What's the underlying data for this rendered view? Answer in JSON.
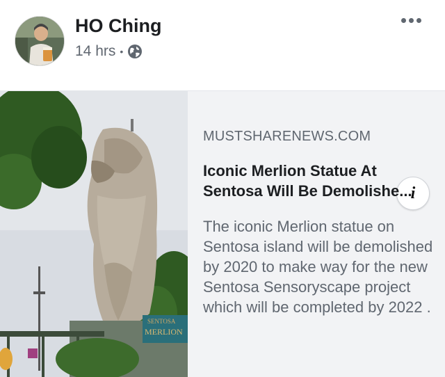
{
  "post": {
    "author": "HO Ching",
    "time": "14 hrs",
    "separator": "•",
    "privacy_icon": "globe-icon",
    "more_icon": "more-options-icon"
  },
  "link_preview": {
    "domain": "MUSTSHARENEWS.COM",
    "title": "Iconic Merlion Statue At Sentosa Will Be Demolishe...",
    "description": "The iconic Merlion statue on Sentosa island will be demolished by 2020 to make way for the new Sentosa Sensoryscape project which will be completed by 2022 .",
    "info_label": "i",
    "image_sign": [
      "SENTOSA",
      "MERLION"
    ]
  },
  "colors": {
    "text_primary": "#1c1e21",
    "text_secondary": "#606770",
    "card_background": "#f2f3f5"
  }
}
